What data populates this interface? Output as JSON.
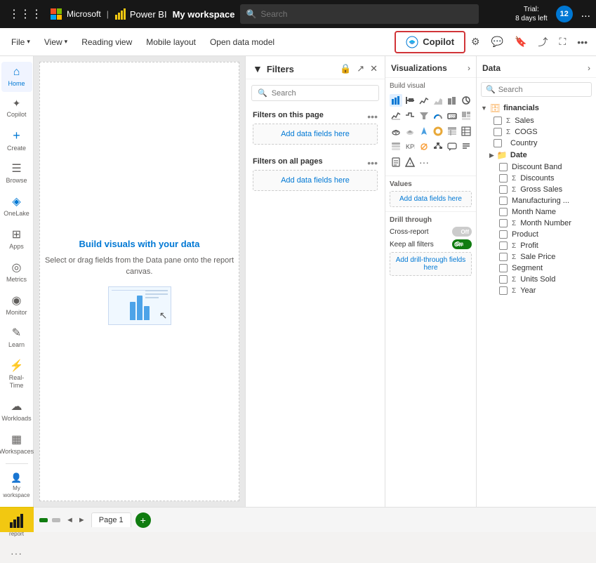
{
  "topbar": {
    "app_name": "Microsoft",
    "powerbi_label": "Power BI",
    "workspace_label": "My workspace",
    "search_placeholder": "Search",
    "trial_text": "Trial:\n8 days left",
    "avatar_initials": "12",
    "ellipsis": "..."
  },
  "ribbon": {
    "file_label": "File",
    "view_label": "View",
    "reading_view_label": "Reading view",
    "mobile_layout_label": "Mobile layout",
    "open_data_model_label": "Open data model",
    "copilot_label": "Copilot"
  },
  "sidebar": {
    "items": [
      {
        "id": "home",
        "label": "Home",
        "icon": "⌂"
      },
      {
        "id": "copilot",
        "label": "Copilot",
        "icon": "✦"
      },
      {
        "id": "create",
        "label": "Create",
        "icon": "+"
      },
      {
        "id": "browse",
        "label": "Browse",
        "icon": "☰"
      },
      {
        "id": "onelake",
        "label": "OneLake",
        "icon": "◈"
      },
      {
        "id": "apps",
        "label": "Apps",
        "icon": "⊞"
      },
      {
        "id": "metrics",
        "label": "Metrics",
        "icon": "◎"
      },
      {
        "id": "monitor",
        "label": "Monitor",
        "icon": "◉"
      },
      {
        "id": "learn",
        "label": "Learn",
        "icon": "✎"
      },
      {
        "id": "realtime",
        "label": "Real-Time",
        "icon": "⚡"
      },
      {
        "id": "workloads",
        "label": "Workloads",
        "icon": "☁"
      },
      {
        "id": "workspaces",
        "label": "Workspaces",
        "icon": "▦"
      }
    ],
    "bottom_items": [
      {
        "id": "my-workspace",
        "label": "My workspace",
        "icon": "👤"
      },
      {
        "id": "untitled-report",
        "label": "Untitled report",
        "icon": "📊"
      },
      {
        "id": "more",
        "label": "",
        "icon": "•••"
      }
    ]
  },
  "canvas": {
    "placeholder_title": "Build visuals with your data",
    "placeholder_subtitle": "Select or drag fields from the Data pane onto the report canvas."
  },
  "filters": {
    "panel_title": "Filters",
    "search_placeholder": "Search",
    "on_this_page_label": "Filters on this page",
    "on_all_pages_label": "Filters on all pages",
    "add_data_fields_label": "Add data fields here"
  },
  "visualizations": {
    "panel_title": "Visualizations",
    "build_visual_label": "Build visual",
    "values_label": "Values",
    "drill_through_label": "Drill through",
    "cross_report_label": "Cross-report",
    "keep_all_filters_label": "Keep all filters",
    "add_data_fields_label": "Add data fields here",
    "add_drill_fields_label": "Add drill-through fields here",
    "cross_report_state": "OFF",
    "keep_filters_state": "ON"
  },
  "data": {
    "panel_title": "Data",
    "search_placeholder": "Search",
    "groups": [
      {
        "name": "financials",
        "expanded": true,
        "items": [
          {
            "name": "Sales",
            "type": "measure"
          },
          {
            "name": "COGS",
            "type": "measure"
          },
          {
            "name": "Country",
            "type": "field"
          }
        ],
        "subgroups": [
          {
            "name": "Date",
            "items": [
              {
                "name": "Discount Band",
                "type": "field"
              },
              {
                "name": "Discounts",
                "type": "measure"
              },
              {
                "name": "Gross Sales",
                "type": "measure"
              },
              {
                "name": "Manufacturing ...",
                "type": "field"
              },
              {
                "name": "Month Name",
                "type": "field"
              },
              {
                "name": "Month Number",
                "type": "measure"
              },
              {
                "name": "Product",
                "type": "field"
              },
              {
                "name": "Profit",
                "type": "measure"
              },
              {
                "name": "Sale Price",
                "type": "measure"
              },
              {
                "name": "Segment",
                "type": "field"
              },
              {
                "name": "Units Sold",
                "type": "measure"
              },
              {
                "name": "Year",
                "type": "measure"
              }
            ]
          }
        ]
      }
    ]
  },
  "bottombar": {
    "page_label": "Page 1",
    "add_page_label": "+",
    "powerbi_icon": "▮"
  }
}
